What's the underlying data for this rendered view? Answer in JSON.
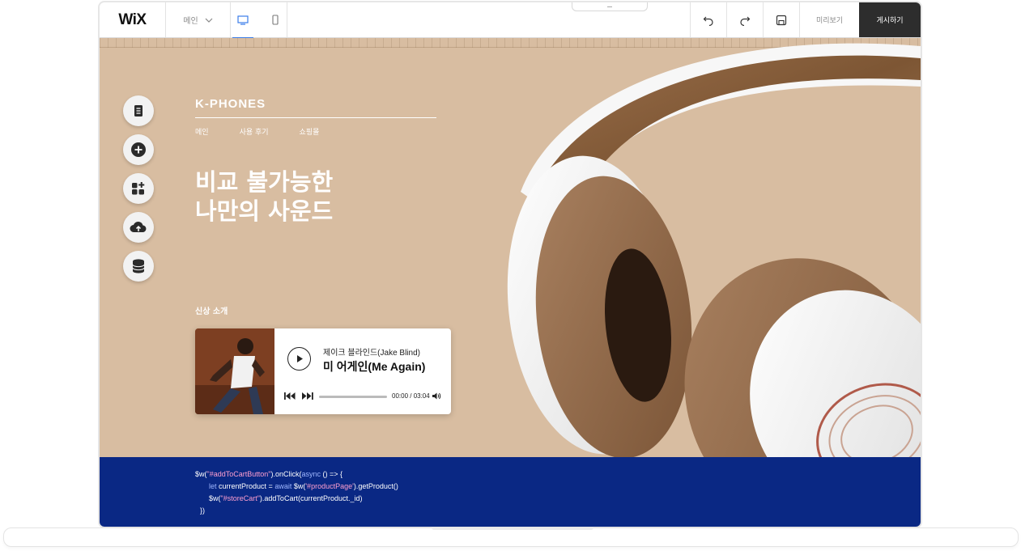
{
  "toolbar": {
    "logo": "WiX",
    "page_select": "메인",
    "preview_label": "미리보기",
    "publish_label": "게시하기"
  },
  "site": {
    "brand": "K-PHONES",
    "nav": [
      "메인",
      "사용 후기",
      "쇼핑몰"
    ],
    "headline_line1": "비교 불가능한",
    "headline_line2": "나만의 사운드",
    "new_label": "신상 소개"
  },
  "player": {
    "artist": "제이크 블라인드(Jake Blind)",
    "track": "미 어게인(Me Again)",
    "time": "00:00 / 03:04",
    "progress": 0
  },
  "code": {
    "line1_a": "$w(",
    "line1_b": "\"#addToCartButton\"",
    "line1_c": ").onClick(",
    "line1_d": "async",
    "line1_e": " () => {",
    "line2_a": "let",
    "line2_b": " currentProduct = ",
    "line2_c": "await",
    "line2_d": " $w(",
    "line2_e": "'#productPage'",
    "line2_f": ").getProduct()",
    "line3_a": "$w(",
    "line3_b": "\"#storeCart\"",
    "line3_c": ").addToCart(currentProduct._id)",
    "line4": "})"
  },
  "colors": {
    "canvas_bg": "#d8bda1",
    "code_bg": "#0a2884",
    "publish_bg": "#2d2d2d",
    "accent": "#3b7de9"
  },
  "icons": {
    "tools": [
      "pages-icon",
      "add-icon",
      "add-apps-icon",
      "upload-icon",
      "database-icon"
    ]
  }
}
